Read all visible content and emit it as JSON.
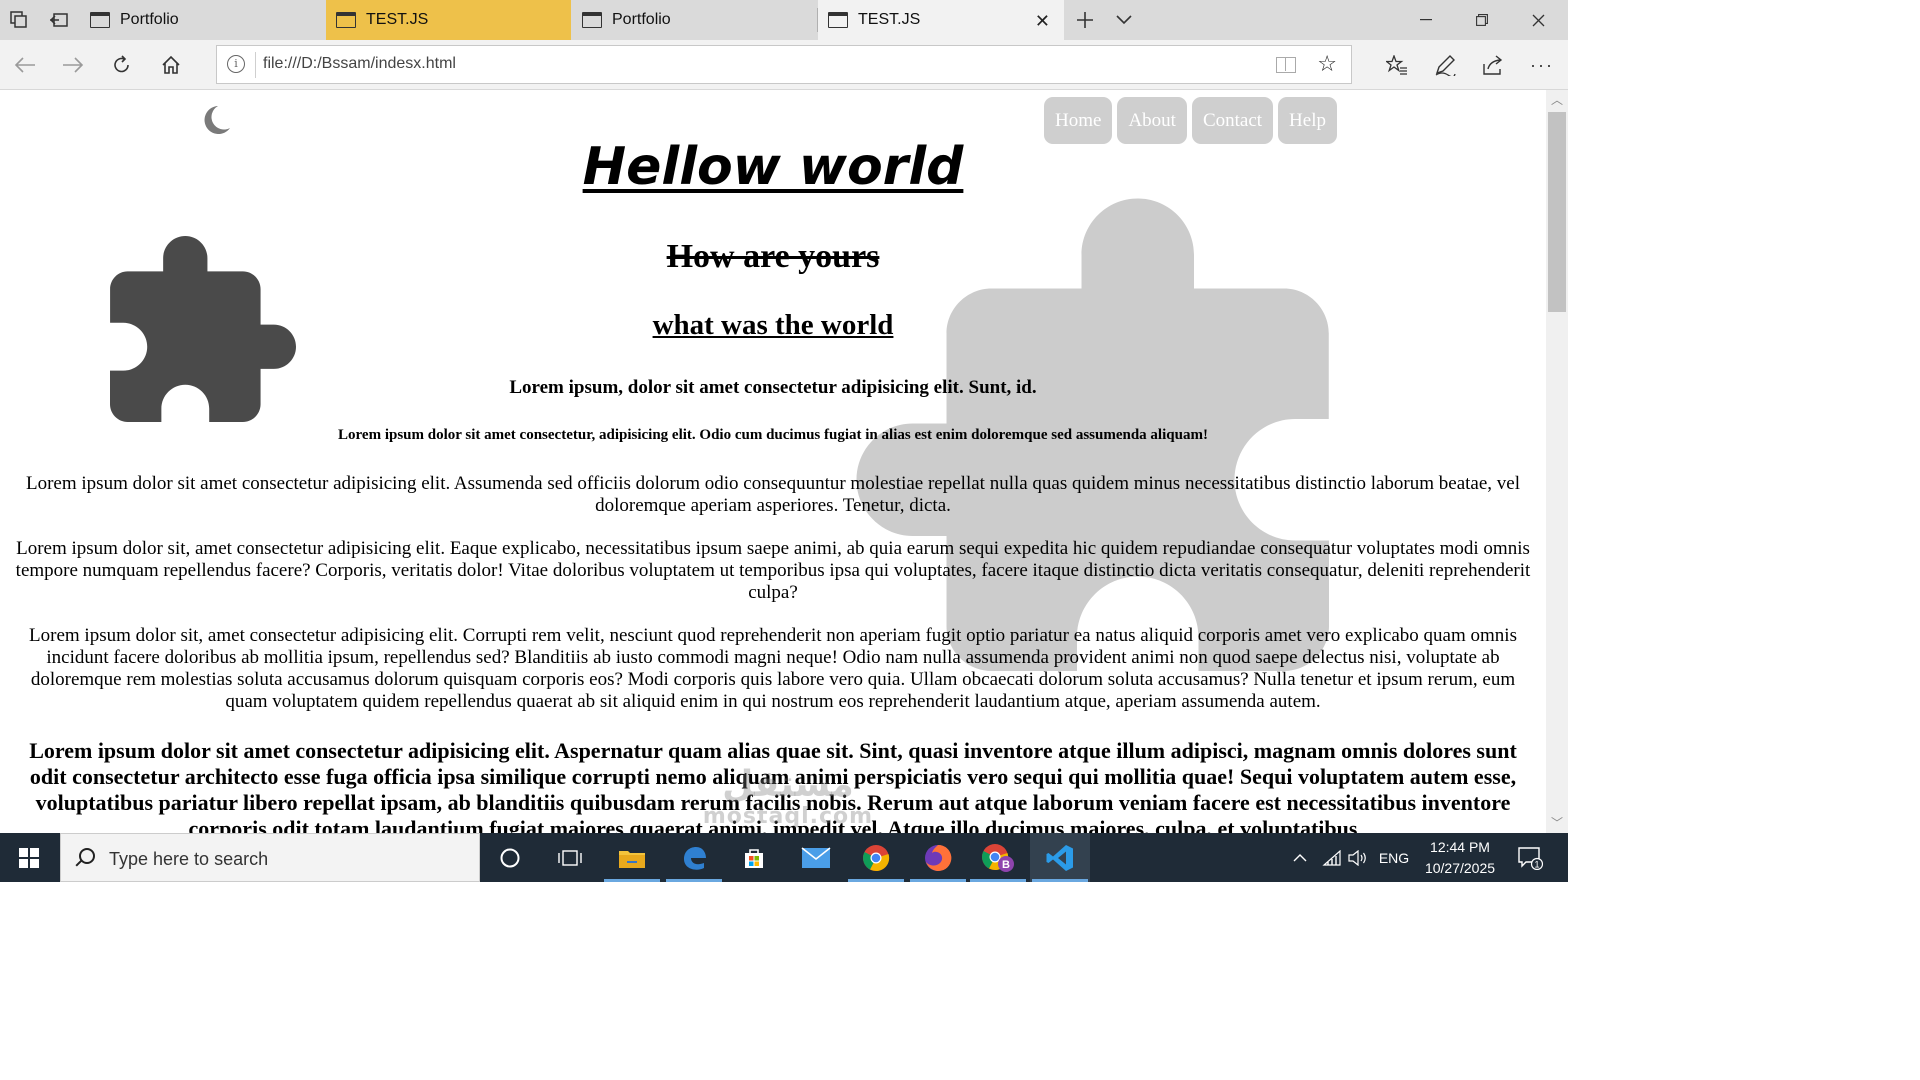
{
  "browser": {
    "tabs": [
      {
        "title": "Portfolio"
      },
      {
        "title": "TEST.JS"
      },
      {
        "title": "Portfolio"
      },
      {
        "title": "TEST.JS"
      }
    ],
    "address": {
      "url": "file:///D:/Bssam/indesx.html"
    }
  },
  "page": {
    "nav": {
      "home": "Home",
      "about": "About",
      "contact": "Contact",
      "help": "Help"
    },
    "heading1": "Hellow world",
    "heading2": "How are yours",
    "heading3": "what was the world",
    "heading4": "Lorem ipsum, dolor sit amet consectetur adipisicing elit. Sunt, id.",
    "heading5": "Lorem ipsum dolor sit amet consectetur, adipisicing elit. Odio cum ducimus fugiat in alias est enim doloremque sed assumenda aliquam!",
    "paragraph1": "Lorem ipsum dolor sit amet consectetur adipisicing elit. Assumenda sed officiis dolorum odio consequuntur molestiae repellat nulla quas quidem minus necessitatibus distinctio laborum beatae, vel doloremque aperiam asperiores. Tenetur, dicta.",
    "paragraph2": "Lorem ipsum dolor sit, amet consectetur adipisicing elit. Eaque explicabo, necessitatibus ipsum saepe animi, ab quia earum sequi expedita hic quidem repudiandae consequatur voluptates modi omnis tempore numquam repellendus facere? Corporis, veritatis dolor! Vitae doloribus voluptatem ut temporibus ipsa qui voluptates, facere itaque distinctio dicta veritatis consequatur, deleniti reprehenderit culpa?",
    "paragraph3": "Lorem ipsum dolor sit, amet consectetur adipisicing elit. Corrupti rem velit, nesciunt quod reprehenderit non aperiam fugit optio pariatur ea natus aliquid corporis amet vero explicabo quam omnis incidunt facere doloribus ab mollitia ipsum, repellendus sed? Blanditiis ab iusto commodi magni neque! Odio nam nulla assumenda provident animi non quod saepe delectus nisi, voluptate ab doloremque rem molestias soluta accusamus dolorum quisquam corporis eos? Modi corporis quis labore vero quia. Ullam obcaecati dolorum soluta accusamus? Nulla tenetur et ipsum rerum, eum quam voluptatem quidem repellendus quaerat ab sit aliquid enim in qui nostrum eos reprehenderit laudantium atque, aperiam assumenda autem.",
    "paragraph4": "Lorem ipsum dolor sit amet consectetur adipisicing elit. Aspernatur quam alias quae sit. Sint, quasi inventore atque illum adipisci, magnam omnis dolores sunt odit consectetur architecto esse fuga officia ipsa similique corrupti nemo aliquam animi perspiciatis vero sequi qui mollitia quae! Sequi voluptatem autem esse, voluptatibus pariatur libero repellat ipsam, ab blanditiis quibusdam rerum facilis nobis. Rerum aut atque laborum veniam facere est necessitatibus inventore corporis odit totam laudantium fugiat maiores quaerat animi, impedit vel. Atque illo ducimus maiores, culpa, et voluptatibus"
  },
  "watermark": {
    "line1": "مستقل",
    "line2": "mostaql.com"
  },
  "taskbar": {
    "search_placeholder": "Type here to search",
    "language": "ENG",
    "time": "12:44 PM",
    "date": "10/27/2025",
    "notification_count": "1",
    "chrome_profile_letter": "B"
  },
  "colors": {
    "accent_tab": "#eec14a",
    "nav_button": "#cfcfcf",
    "puzzle_dark": "#4a4a4a",
    "puzzle_light": "#cccccc",
    "taskbar": "#1f2b37"
  }
}
